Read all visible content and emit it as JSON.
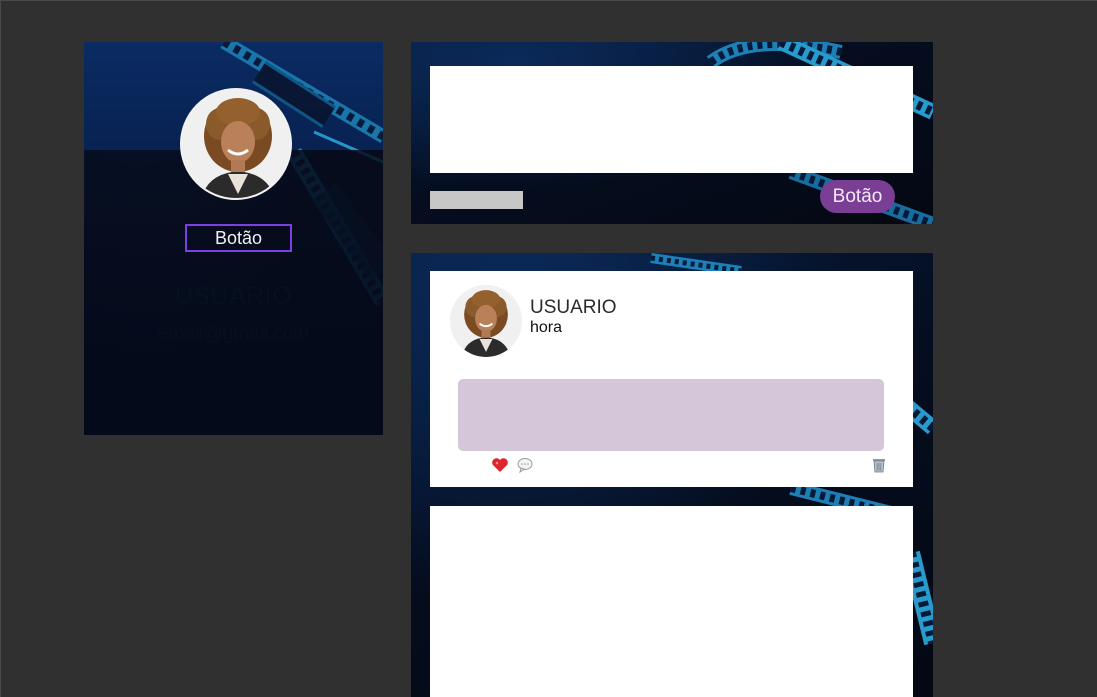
{
  "profile": {
    "avatar_alt": "Foto do usuário",
    "button_label": "Botão",
    "name": "USUARIO",
    "email": "email@gmail.com"
  },
  "composer": {
    "text_value": "",
    "button_label": "Botão"
  },
  "feed": {
    "posts": [
      {
        "user": "USUARIO",
        "time": "hora",
        "body": "",
        "actions": [
          "heart-icon",
          "comment-icon",
          "trash-icon"
        ]
      }
    ]
  },
  "colors": {
    "background": "#303030",
    "panel_dark": "#050d1f",
    "film_accent": "#2aa3d6",
    "profile_button_border": "#7b3fe4",
    "pill_button": "#7a3e95",
    "post_body": "#d5c6d9"
  }
}
